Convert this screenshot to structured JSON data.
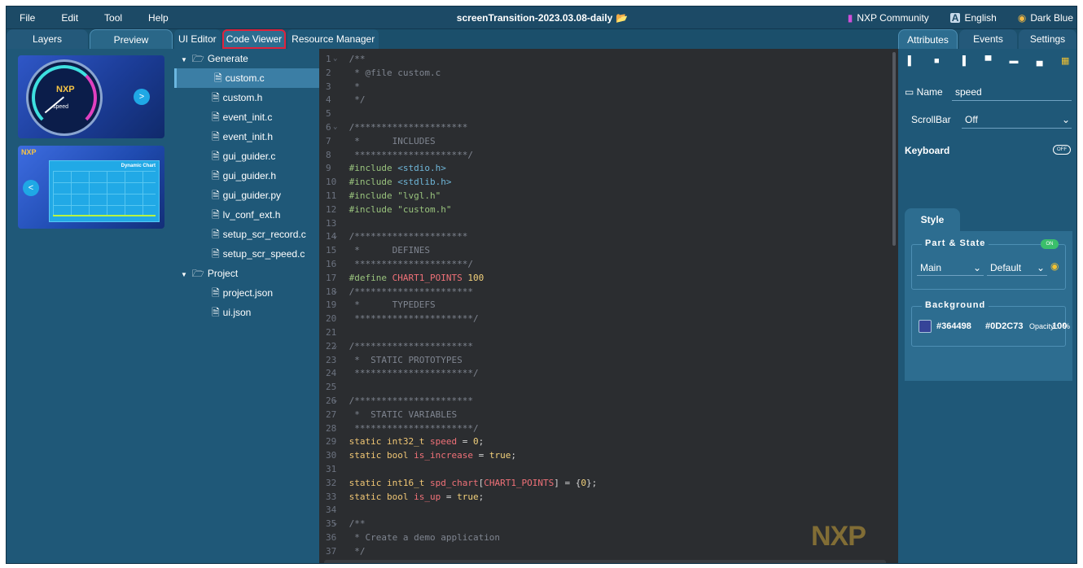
{
  "menubar": {
    "items": [
      "File",
      "Edit",
      "Tool",
      "Help"
    ],
    "title": "screenTransition-2023.03.08-daily",
    "community": "NXP Community",
    "language": "English",
    "theme": "Dark Blue"
  },
  "left_tabs": [
    "Layers",
    "Preview"
  ],
  "previews": {
    "screen1": {
      "logo": "NXP",
      "gauge_label": "speed"
    },
    "screen2": {
      "logo": "NXP",
      "chart_title": "Dynamic Chart"
    }
  },
  "center_tabs": [
    "UI Editor",
    "Code Viewer",
    "Resource Manager"
  ],
  "tree": {
    "generate": {
      "label": "Generate",
      "files": [
        "custom.c",
        "custom.h",
        "event_init.c",
        "event_init.h",
        "gui_guider.c",
        "gui_guider.h",
        "gui_guider.py",
        "lv_conf_ext.h",
        "setup_scr_record.c",
        "setup_scr_speed.c"
      ],
      "selected": "custom.c"
    },
    "project": {
      "label": "Project",
      "files": [
        "project.json",
        "ui.json"
      ]
    }
  },
  "code": {
    "lines": [
      "/**",
      " * @file custom.c",
      " *",
      " */",
      "",
      "/*********************",
      " *      INCLUDES",
      " *********************/",
      "#include <stdio.h>",
      "#include <stdlib.h>",
      "#include \"lvgl.h\"",
      "#include \"custom.h\"",
      "",
      "/*********************",
      " *      DEFINES",
      " *********************/",
      "#define CHART1_POINTS 100",
      "/**********************",
      " *      TYPEDEFS",
      " **********************/",
      "",
      "/**********************",
      " *  STATIC PROTOTYPES",
      " **********************/",
      "",
      "/**********************",
      " *  STATIC VARIABLES",
      " **********************/",
      "static int32_t speed = 0;",
      "static bool is_increase = true;",
      "",
      "static int16_t spd_chart[CHART1_POINTS] = {0};",
      "static bool is_up = true;",
      "",
      "/**",
      " * Create a demo application",
      " */"
    ],
    "watermark": "NXP"
  },
  "right_tabs": [
    "Attributes",
    "Events",
    "Settings"
  ],
  "attributes": {
    "name_label": "Name",
    "name_value": "speed",
    "scrollbar_label": "ScrollBar",
    "scrollbar_value": "Off",
    "keyboard_label": "Keyboard",
    "keyboard_toggle": "OFF",
    "style_tab": "Style",
    "part_state_title": "Part & State",
    "part_state_toggle": "ON",
    "part_value": "Main",
    "state_value": "Default",
    "background_title": "Background",
    "bg_color1": "#364498",
    "bg_color2": "#0D2C73",
    "opacity_label": "Opacity :",
    "opacity_value": "100",
    "opacity_unit": "%"
  },
  "colors": {
    "panel": "#1f5878",
    "editor_bg": "#2b2d30",
    "highlight_box": "#e0223c",
    "swatch": "#364498"
  }
}
